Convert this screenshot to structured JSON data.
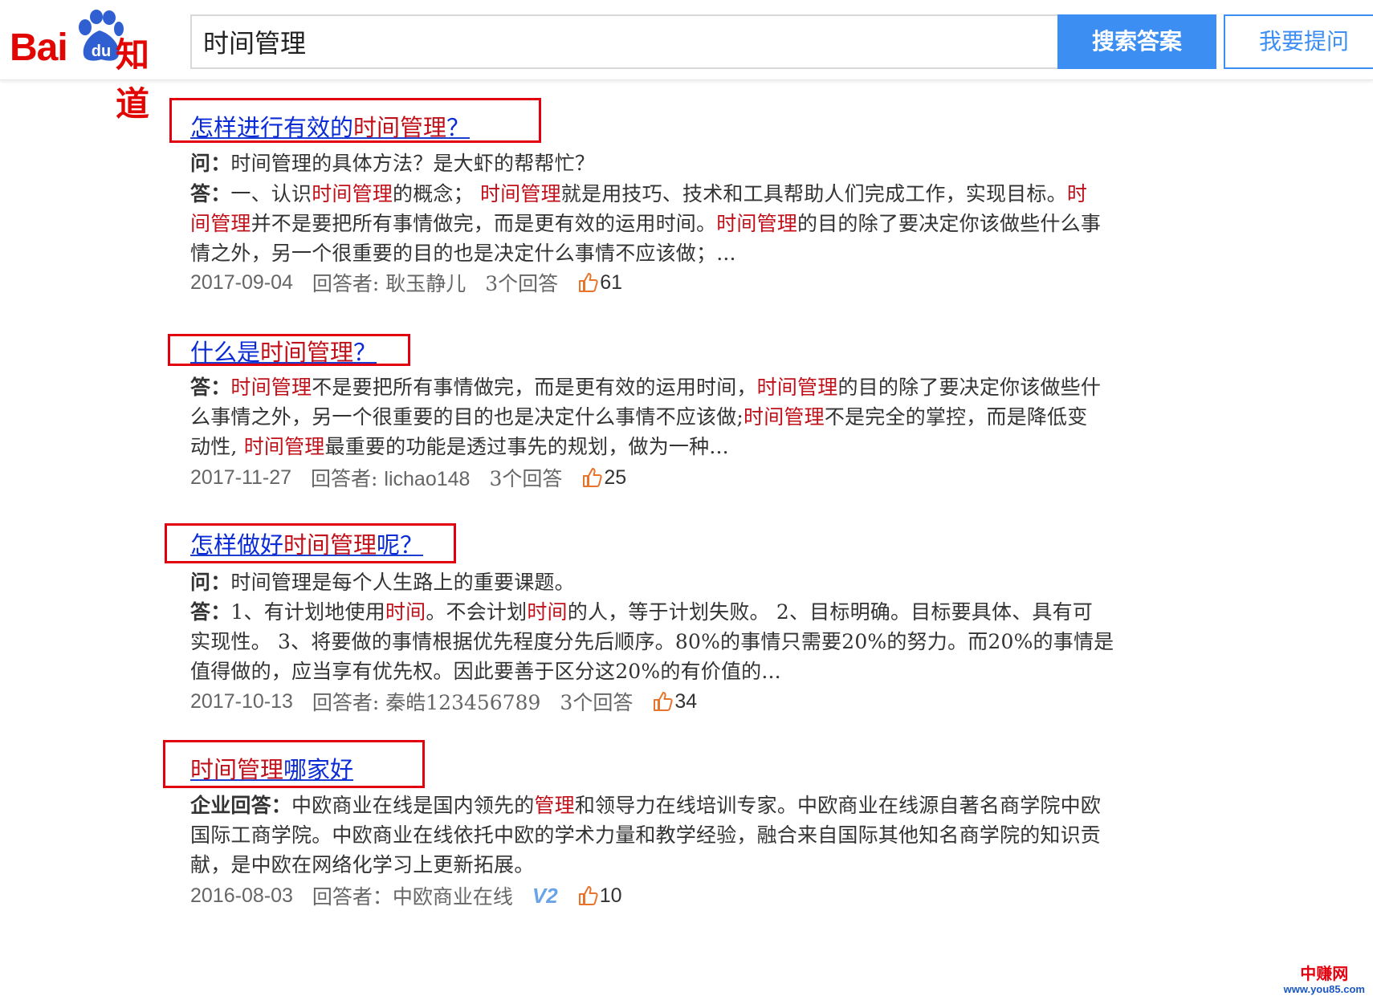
{
  "header": {
    "logo": {
      "text_bai": "Bai",
      "text_du": "du",
      "text_zhidao": "知道"
    },
    "search": {
      "value": "时间管理",
      "placeholder": ""
    },
    "search_button": "搜索答案",
    "ask_button": "我要提问"
  },
  "results": [
    {
      "title_pre": "怎样进行有效的",
      "title_hl": "时间管理",
      "title_post": "？",
      "question_label": "问：",
      "question": "时间管理的具体方法？是大虾的帮帮忙？",
      "answer_label": "答：",
      "answer_lines": [
        [
          {
            "t": "一、认识"
          },
          {
            "t": "时间管理",
            "hl": true
          },
          {
            "t": "的概念； "
          },
          {
            "t": "时间管理",
            "hl": true
          },
          {
            "t": "就是用技巧、技术和工具帮助人们完成工作，实现目标。"
          },
          {
            "t": "时",
            "hl": true
          }
        ],
        [
          {
            "t": "间管理",
            "hl": true
          },
          {
            "t": "并不是要把所有事情做完，而是更有效的运用时间。"
          },
          {
            "t": "时间管理",
            "hl": true
          },
          {
            "t": "的目的除了要决定你该做些什么事"
          }
        ],
        [
          {
            "t": "情之外，另一个很重要的目的也是决定什么事情不应该做；..."
          }
        ]
      ],
      "date": "2017-09-04",
      "answerer_label": "回答者: ",
      "answerer": "耿玉静儿",
      "answers_count": "3个回答",
      "likes": "61"
    },
    {
      "title_pre": "什么是",
      "title_hl": "时间管理",
      "title_post": "？",
      "answer_label": "答：",
      "answer_lines": [
        [
          {
            "t": "时间管理",
            "hl": true
          },
          {
            "t": "不是要把所有事情做完，而是更有效的运用时间，"
          },
          {
            "t": "时间管理",
            "hl": true
          },
          {
            "t": "的目的除了要决定你该做些什"
          }
        ],
        [
          {
            "t": "么事情之外，另一个很重要的目的也是决定什么事情不应该做;"
          },
          {
            "t": "时间管理",
            "hl": true
          },
          {
            "t": "不是完全的掌控，而是降低变"
          }
        ],
        [
          {
            "t": "动性, "
          },
          {
            "t": "时间管理",
            "hl": true
          },
          {
            "t": "最重要的功能是透过事先的规划，做为一种..."
          }
        ]
      ],
      "date": "2017-11-27",
      "answerer_label": "回答者: ",
      "answerer": "lichao148",
      "answers_count": "3个回答",
      "likes": "25"
    },
    {
      "title_pre": "怎样做好",
      "title_hl": "时间管理",
      "title_post": "呢？",
      "question_label": "问：",
      "question": "时间管理是每个人生路上的重要课题。",
      "answer_label": "答：",
      "answer_lines": [
        [
          {
            "t": "1、有计划地使用"
          },
          {
            "t": "时间",
            "hl": true
          },
          {
            "t": "。不会计划"
          },
          {
            "t": "时间",
            "hl": true
          },
          {
            "t": "的人，等于计划失败。 2、目标明确。目标要具体、具有可"
          }
        ],
        [
          {
            "t": "实现性。 3、将要做的事情根据优先程度分先后顺序。80%的事情只需要20%的努力。而20%的事情是"
          }
        ],
        [
          {
            "t": "值得做的，应当享有优先权。因此要善于区分这20%的有价值的..."
          }
        ]
      ],
      "date": "2017-10-13",
      "answerer_label": "回答者: ",
      "answerer": "秦皓123456789",
      "answers_count": "3个回答",
      "likes": "34"
    },
    {
      "title_pre": "",
      "title_hl": "时间管理",
      "title_post": "哪家好",
      "answer_label": "企业回答：",
      "answer_lines": [
        [
          {
            "t": "中欧商业在线是国内领先的"
          },
          {
            "t": "管理",
            "hl": true
          },
          {
            "t": "和领导力在线培训专家。中欧商业在线源自著名商学院中欧"
          }
        ],
        [
          {
            "t": "国际工商学院。中欧商业在线依托中欧的学术力量和教学经验，融合来自国际其他知名商学院的知识贡"
          }
        ],
        [
          {
            "t": "献，是中欧在网络化学习上更新拓展。"
          }
        ]
      ],
      "date": "2016-08-03",
      "answerer_label": "回答者：",
      "answerer": "中欧商业在线",
      "badge": "V2",
      "likes": "10"
    }
  ],
  "watermark": {
    "line1": "中赚网",
    "line2": "www.you85.com"
  },
  "colors": {
    "highlight": "#c0111b",
    "link": "#0a2bd6",
    "box": "#e2000e",
    "accent": "#3c8ef2"
  }
}
